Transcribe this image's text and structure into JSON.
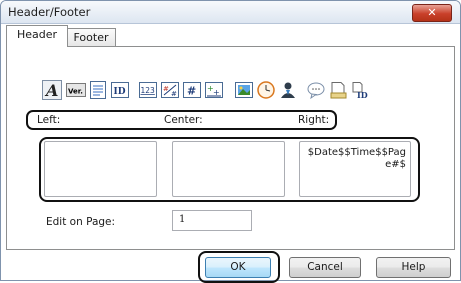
{
  "window": {
    "title": "Header/Footer",
    "close_glyph": "✕"
  },
  "tabs": [
    {
      "label": "Header",
      "selected": true
    },
    {
      "label": "Footer",
      "selected": false
    }
  ],
  "toolbar": {
    "icons": [
      "font-icon",
      "version-icon",
      "document-icon",
      "id-icon",
      "page-number-icon",
      "page-count-icon",
      "hash-icon",
      "add-field-icon",
      "image-icon",
      "clock-icon",
      "person-icon",
      "comment-icon",
      "file-icon",
      "file-id-icon"
    ],
    "ver_text": "Ver.",
    "id_text": "ID",
    "num_text": "123"
  },
  "sections": {
    "left_label": "Left:",
    "center_label": "Center:",
    "right_label": "Right:"
  },
  "fields": {
    "left_value": "",
    "center_value": "",
    "right_value": "$Date$$Time$$Page#$"
  },
  "edit_on_page": {
    "label": "Edit on Page:",
    "value": "1"
  },
  "buttons": {
    "ok": "OK",
    "cancel": "Cancel",
    "help": "Help"
  }
}
